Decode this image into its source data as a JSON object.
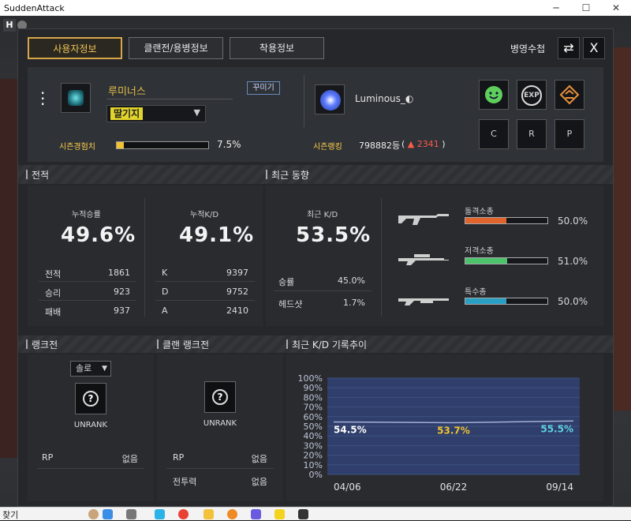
{
  "window": {
    "title": "SuddenAttack"
  },
  "tabs": [
    {
      "label": "사용자정보"
    },
    {
      "label": "클랜전/용병정보"
    },
    {
      "label": "착용정보"
    }
  ],
  "header": {
    "action_label": "병영수첩",
    "swap_icon": "swap-icon",
    "close_label": "X"
  },
  "profile": {
    "nickname": "루미너스",
    "decorate_label": "꾸미기",
    "color_select": "딸기지",
    "account": "Luminous_◐",
    "buttons": {
      "c": "C",
      "r": "R",
      "p": "P",
      "exp": "EXP"
    },
    "season_xp_label": "시즌경험치",
    "season_xp_value": "7.5%",
    "season_xp_fraction": 0.075,
    "season_rank_label": "시즌랭킹",
    "season_rank_value": "798882등",
    "season_rank_change": "▲ 2341"
  },
  "record": {
    "title": "전적",
    "winrate_label": "누적승률",
    "winrate": "49.6%",
    "kd_label": "누적K/D",
    "kd": "49.1%",
    "left_rows": [
      {
        "label": "전적",
        "value": "1861"
      },
      {
        "label": "승리",
        "value": "923"
      },
      {
        "label": "패배",
        "value": "937"
      }
    ],
    "right_rows": [
      {
        "label": "K",
        "value": "9397"
      },
      {
        "label": "D",
        "value": "9752"
      },
      {
        "label": "A",
        "value": "2410"
      }
    ]
  },
  "recent": {
    "title": "최근 동향",
    "kd_label": "최근 K/D",
    "kd": "53.5%",
    "rows": [
      {
        "label": "승률",
        "value": "45.0%"
      },
      {
        "label": "헤드샷",
        "value": "1.7%"
      }
    ],
    "weapons": [
      {
        "name": "돌격소총",
        "value": "50.0%",
        "fraction": 0.5,
        "color": "#e0642c"
      },
      {
        "name": "저격소총",
        "value": "51.0%",
        "fraction": 0.51,
        "color": "#4cc36a"
      },
      {
        "name": "특수총",
        "value": "50.0%",
        "fraction": 0.5,
        "color": "#2a9fc4"
      }
    ]
  },
  "rank": {
    "title": "랭크전",
    "mode_select": "솔로",
    "status": "UNRANK",
    "rp_label": "RP",
    "rp_value": "없음"
  },
  "clan_rank": {
    "title": "클랜 랭크전",
    "status": "UNRANK",
    "rp_label": "RP",
    "rp_value": "없음",
    "power_label": "전투력",
    "power_value": "없음"
  },
  "trend": {
    "title": "최근 K/D 기록추이"
  },
  "chart_data": {
    "type": "line",
    "title": "최근 K/D 기록추이",
    "x": [
      "04/06",
      "06/22",
      "09/14"
    ],
    "series": [
      {
        "values": [
          54.5,
          53.7,
          55.5
        ]
      }
    ],
    "point_labels": [
      "54.5%",
      "53.7%",
      "55.5%"
    ],
    "point_colors": [
      "#ffffff",
      "#f1c232",
      "#5fd3e0"
    ],
    "yticks": [
      "100%",
      "90%",
      "80%",
      "70%",
      "60%",
      "50%",
      "40%",
      "30%",
      "20%",
      "10%",
      "0%"
    ],
    "ylim": [
      0,
      100
    ],
    "grid": true
  },
  "taskbar": {
    "left_label": "찾기"
  }
}
